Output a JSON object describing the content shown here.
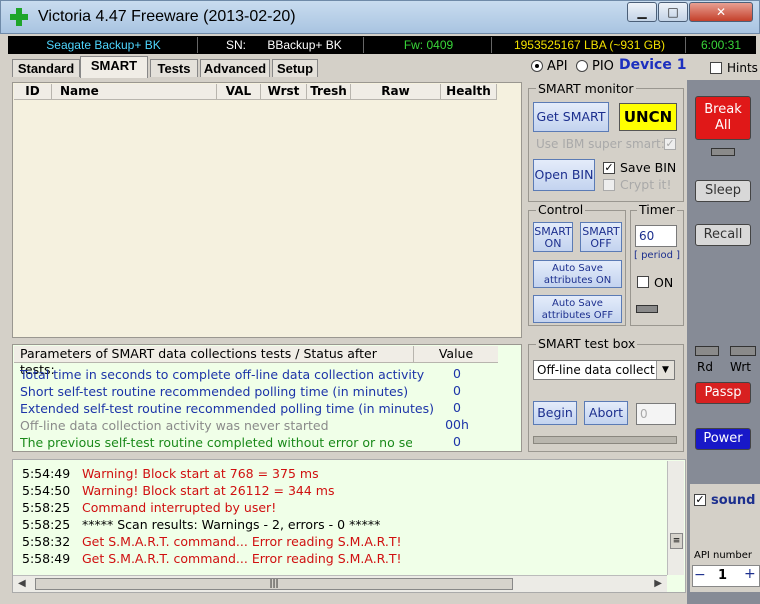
{
  "window": {
    "title": "Victoria 4.47  Freeware (2013-02-20)",
    "minimize": "▁",
    "maximize": "□",
    "close": "✕"
  },
  "info_bar": {
    "model": "Seagate Backup+ BK",
    "sn_label": "SN:",
    "sn_value": "BBackup+ BK",
    "fw": "Fw: 0409",
    "lba": "1953525167 LBA (~931 GB)",
    "time": "6:00:31"
  },
  "tabs": [
    {
      "label": "Standard"
    },
    {
      "label": "SMART"
    },
    {
      "label": "Tests"
    },
    {
      "label": "Advanced"
    },
    {
      "label": "Setup"
    }
  ],
  "mode": {
    "api_label": "API",
    "pio_label": "PIO",
    "device_label": "Device 1",
    "hints_label": "Hints"
  },
  "smart_table": {
    "columns": [
      "ID",
      "Name",
      "VAL",
      "Wrst",
      "Tresh",
      "Raw",
      "Health"
    ]
  },
  "params": {
    "header": "Parameters of SMART data collections tests / Status after tests:",
    "value_header": "Value",
    "rows": [
      {
        "text": "Total time in seconds to complete off-line data collection activity",
        "value": "0",
        "color": "#1c34a8"
      },
      {
        "text": "Short self-test routine recommended polling time (in minutes)",
        "value": "0",
        "color": "#1c34a8"
      },
      {
        "text": "Extended self-test routine recommended polling time (in minutes)",
        "value": "0",
        "color": "#1c34a8"
      },
      {
        "text": "Off-line data collection activity was never started",
        "value": "00h",
        "color": "#8a8a8a"
      },
      {
        "text": "The previous self-test routine completed without error or no self-t...",
        "value": "0",
        "color": "#1a8a1a"
      }
    ]
  },
  "smart_monitor": {
    "title": "SMART monitor",
    "get_smart": "Get SMART",
    "status": "UNCN",
    "ibm_label": "Use IBM super smart:",
    "open_bin": "Open BIN",
    "save_bin": "Save BIN",
    "crypt": "Crypt it!"
  },
  "control": {
    "title": "Control",
    "smart_on": "SMART ON",
    "smart_off": "SMART OFF",
    "auto_on": "Auto Save attributes ON",
    "auto_off": "Auto Save attributes OFF"
  },
  "timer": {
    "title": "Timer",
    "value": "60",
    "period": "[ period ]",
    "on_label": "ON"
  },
  "test_box": {
    "title": "SMART test box",
    "selected": "Off-line data collect",
    "begin": "Begin",
    "abort": "Abort",
    "field_value": "0"
  },
  "right_panel": {
    "break_all": "Break All",
    "sleep": "Sleep",
    "recall": "Recall",
    "rd": "Rd",
    "wrt": "Wrt",
    "passp": "Passp",
    "power": "Power",
    "sound": "sound",
    "api_number_label": "API number",
    "api_number": "1",
    "minus": "−",
    "plus": "+"
  },
  "log": [
    {
      "time": "5:54:49",
      "msg": "Warning! Block start at 768 = 375 ms",
      "color": "#d01010"
    },
    {
      "time": "5:54:50",
      "msg": "Warning! Block start at 26112 = 344 ms",
      "color": "#d01010"
    },
    {
      "time": "5:58:25",
      "msg": "Command interrupted by user!",
      "color": "#d01010"
    },
    {
      "time": "5:58:25",
      "msg": "***** Scan results: Warnings - 2, errors - 0 *****",
      "color": "#000000"
    },
    {
      "time": "5:58:32",
      "msg": "Get S.M.A.R.T. command... Error reading S.M.A.R.T!",
      "color": "#d01010"
    },
    {
      "time": "5:58:49",
      "msg": "Get S.M.A.R.T. command... Error reading S.M.A.R.T!",
      "color": "#d01010"
    }
  ]
}
